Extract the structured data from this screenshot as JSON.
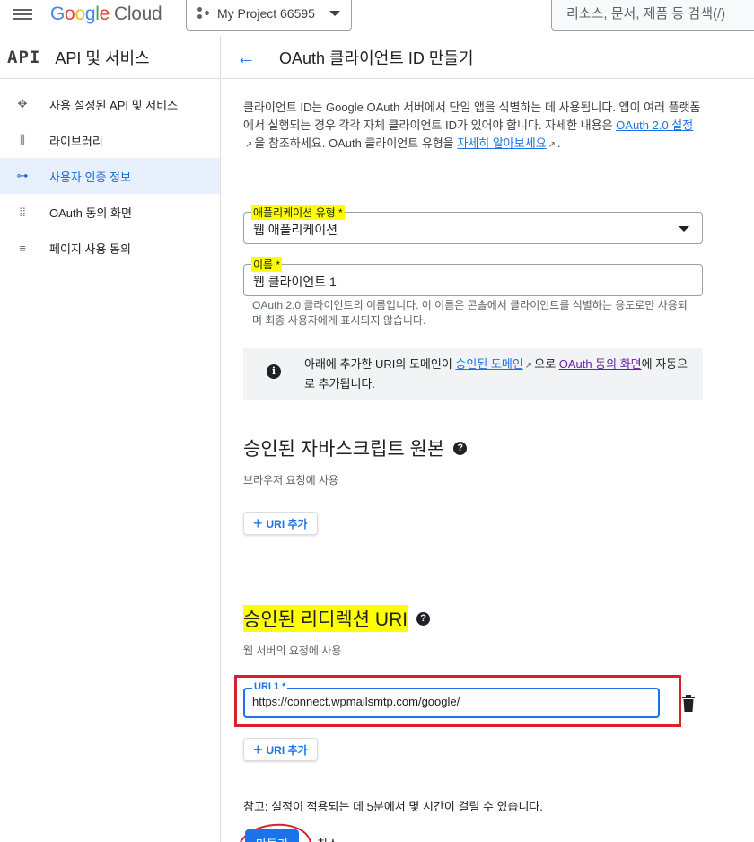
{
  "topbar": {
    "logo": {
      "g1": "G",
      "o1": "o",
      "o2": "o",
      "g2": "g",
      "l": "l",
      "e": "e",
      "cloud": "Cloud"
    },
    "project_name": "My Project 66595",
    "search_placeholder": "리소스, 문서, 제품 등 검색(/)"
  },
  "sidebar": {
    "badge": "API",
    "title": "API 및 서비스",
    "items": [
      {
        "label": "사용 설정된 API 및 서비스",
        "icon": "diamond-dots-icon"
      },
      {
        "label": "라이브러리",
        "icon": "library-icon"
      },
      {
        "label": "사용자 인증 정보",
        "icon": "key-icon",
        "active": true
      },
      {
        "label": "OAuth 동의 화면",
        "icon": "consent-icon"
      },
      {
        "label": "페이지 사용 동의",
        "icon": "settings-list-icon"
      }
    ]
  },
  "page": {
    "title": "OAuth 클라이언트 ID 만들기",
    "intro_1": "클라이언트 ID는 Google OAuth 서버에서 단일 앱을 식별하는 데 사용됩니다. 앱이 여러 플랫폼에서 실행되는 경우 각각 자체 클라이언트 ID가 있어야 합니다. 자세한 내용은 ",
    "intro_link_1": "OAuth 2.0 설정",
    "intro_2": "을 참조하세요. OAuth 클라이언트 유형을 ",
    "intro_link_2": "자세히 알아보세요",
    "intro_3": "."
  },
  "form": {
    "app_type_label": "애플리케이션 유형 *",
    "app_type_value": "웹 애플리케이션",
    "name_label": "이름 *",
    "name_value": "웹 클라이언트 1",
    "name_hint": "OAuth 2.0 클라이언트의 이름입니다. 이 이름은 콘솔에서 클라이언트를 식별하는 용도로만 사용되며 최종 사용자에게 표시되지 않습니다."
  },
  "info": {
    "text_1": "아래에 추가한 URI의 도메인이 ",
    "link_1": "승인된 도메인",
    "text_2": "으로 ",
    "link_2": "OAuth 동의 화면",
    "text_3": "에 자동으로 추가됩니다."
  },
  "js_origins": {
    "title": "승인된 자바스크립트 원본",
    "subtitle": "브라우저 요청에 사용",
    "add_label": "URI 추가"
  },
  "redirects": {
    "title": "승인된 리디렉션 URI",
    "subtitle": "웹 서버의 요청에 사용",
    "uri_label": "URI 1 *",
    "uri_value": "https://connect.wpmailsmtp.com/google/",
    "add_label": "URI 추가"
  },
  "footer": {
    "note": "참고: 설정이 적용되는 데 5분에서 몇 시간이 걸릴 수 있습니다.",
    "create_label": "만들기",
    "cancel_label": "취소"
  },
  "colors": {
    "accent": "#1a73e8",
    "highlight": "#ffff00",
    "annotation_red": "#d9202c"
  }
}
